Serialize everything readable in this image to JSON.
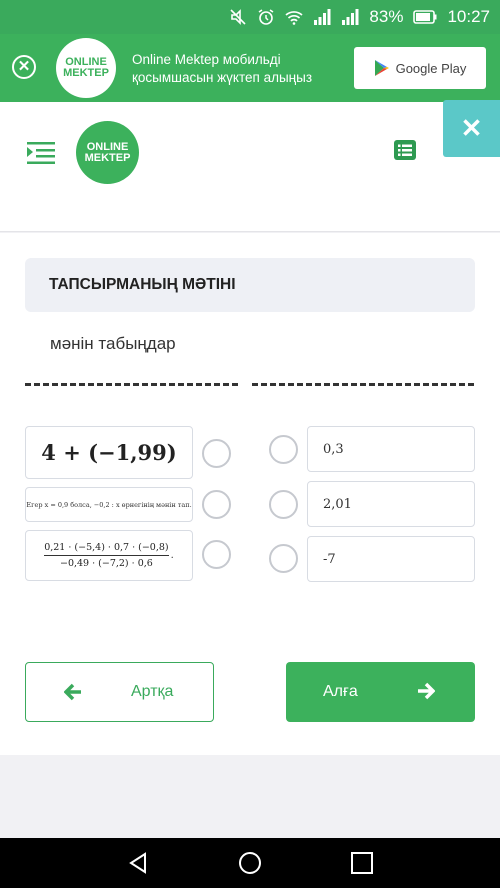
{
  "status_bar": {
    "battery_percent": "83%",
    "time": "10:27",
    "icons": [
      "mute-icon",
      "alarm-icon",
      "wifi-icon",
      "signal-icon",
      "signal-icon",
      "battery-icon"
    ]
  },
  "banner": {
    "logo_line1": "ONLINE",
    "logo_line2": "MEKTEP",
    "text": "Online Mektep мобильді қосымшасын жүктеп алыңыз",
    "store_label": "Google Play"
  },
  "header": {
    "logo_line1": "ONLINE",
    "logo_line2": "MEKTEP"
  },
  "task": {
    "header": "ТАПСЫРМАНЫҢ МӘТІНІ",
    "description": "мәнін табыңдар",
    "left_items": [
      {
        "expr": "4 + (−1,99)"
      },
      {
        "expr": "Егер x = 0,9 болса, −0,2 : x өрнегінің мәнін тап."
      },
      {
        "numerator": "0,21 · (−5,4) · 0,7 · (−0,8)",
        "denominator": "−0,49 · (−7,2) · 0,6",
        "suffix": "."
      }
    ],
    "right_items": [
      {
        "value": "0,3"
      },
      {
        "value": "2,01"
      },
      {
        "value": "-7"
      }
    ]
  },
  "buttons": {
    "back_label": "Артқа",
    "next_label": "Алға"
  },
  "colors": {
    "brand_green": "#3cb15c",
    "teal": "#5bc8c8"
  }
}
